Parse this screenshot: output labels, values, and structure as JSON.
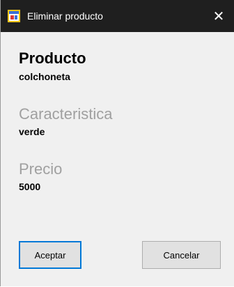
{
  "window": {
    "title": "Eliminar producto",
    "close_glyph": "✕",
    "icon": "app-window-icon"
  },
  "form": {
    "producto_label": "Producto",
    "producto_value": "colchoneta",
    "caracteristica_label": "Caracteristica",
    "caracteristica_value": "verde",
    "precio_label": "Precio",
    "precio_value": "5000"
  },
  "buttons": {
    "accept_label": "Aceptar",
    "cancel_label": "Cancelar"
  },
  "colors": {
    "titlebar": "#1f1f1f",
    "background": "#f0f0f0",
    "muted_label": "#a0a0a0",
    "focus_border": "#0078d7"
  }
}
